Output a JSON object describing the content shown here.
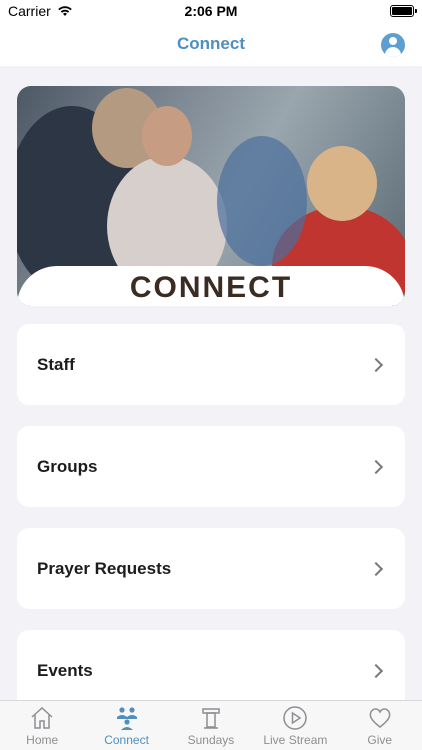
{
  "status_bar": {
    "carrier": "Carrier",
    "time": "2:06 PM"
  },
  "nav": {
    "title": "Connect",
    "profile_icon": "user-icon"
  },
  "hero": {
    "caption": "CONNECT"
  },
  "cards": [
    {
      "label": "Staff"
    },
    {
      "label": "Groups"
    },
    {
      "label": "Prayer Requests"
    },
    {
      "label": "Events"
    }
  ],
  "tabs": [
    {
      "label": "Home",
      "icon": "home-icon",
      "active": false
    },
    {
      "label": "Connect",
      "icon": "people-icon",
      "active": true
    },
    {
      "label": "Sundays",
      "icon": "podium-icon",
      "active": false
    },
    {
      "label": "Live Stream",
      "icon": "play-icon",
      "active": false
    },
    {
      "label": "Give",
      "icon": "heart-icon",
      "active": false
    }
  ],
  "colors": {
    "accent": "#4f8fc0",
    "inactive": "#8e8e93",
    "background": "#f2f2f7"
  }
}
